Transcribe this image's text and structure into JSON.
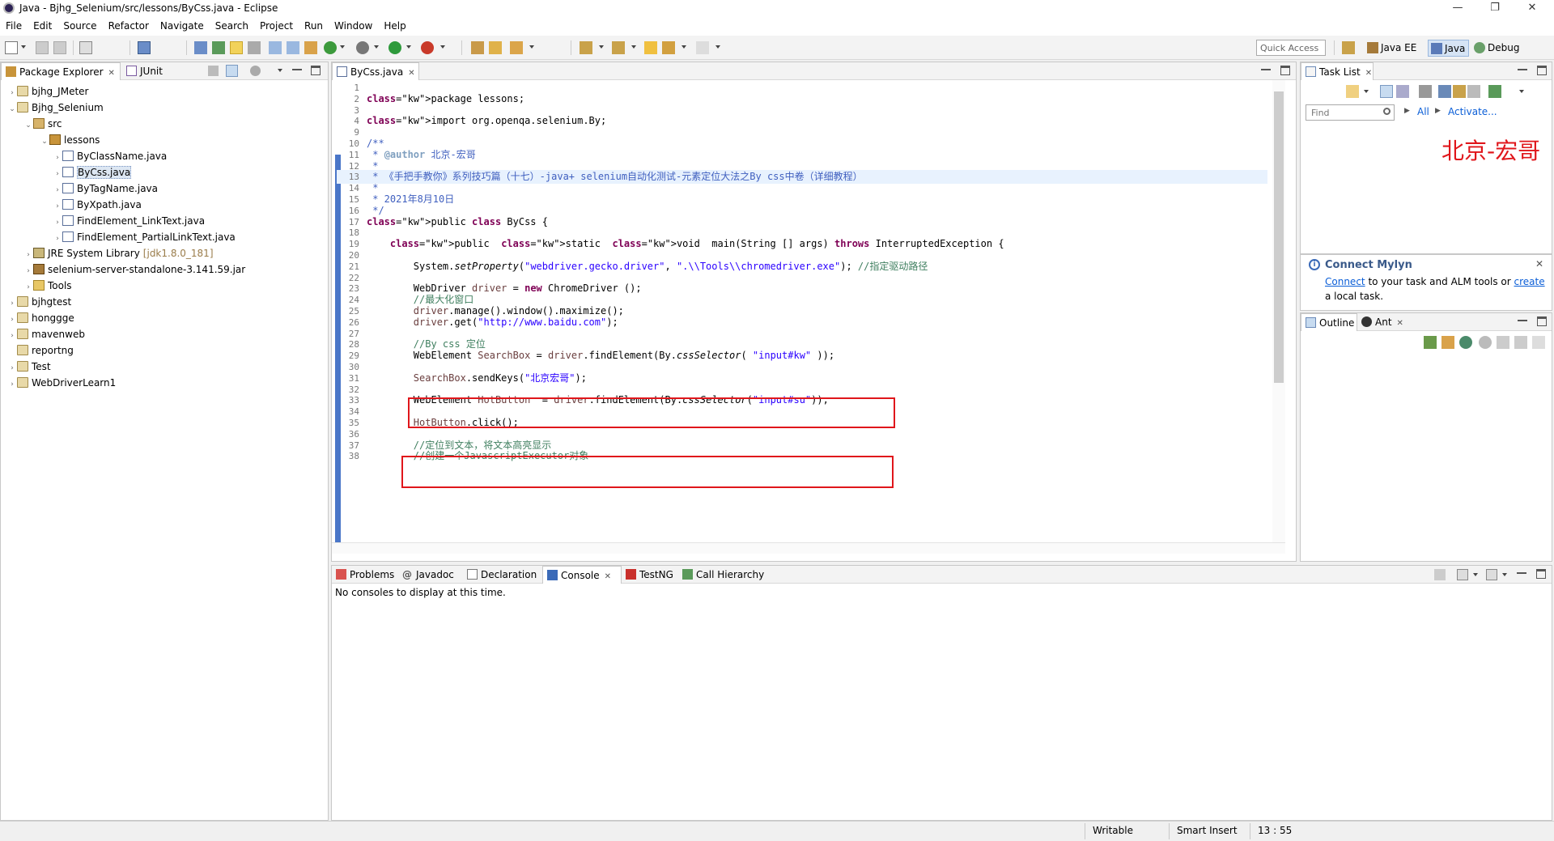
{
  "window": {
    "title": "Java - Bjhg_Selenium/src/lessons/ByCss.java - Eclipse",
    "minimize": "—",
    "restore": "❐",
    "close": "✕"
  },
  "menu": [
    "File",
    "Edit",
    "Source",
    "Refactor",
    "Navigate",
    "Search",
    "Project",
    "Run",
    "Window",
    "Help"
  ],
  "toolbar": {
    "quick_access": "Quick Access",
    "perspectives": [
      "Java EE",
      "Java",
      "Debug"
    ]
  },
  "package_explorer": {
    "tabs": [
      "Package Explorer",
      "JUnit"
    ],
    "tree": [
      {
        "label": "bjhg_JMeter",
        "arrow": "›",
        "icon": "project-icon"
      },
      {
        "label": "Bjhg_Selenium",
        "arrow": "⌄",
        "icon": "project-icon"
      },
      {
        "label": "src",
        "arrow": "⌄",
        "icon": "source-folder-icon"
      },
      {
        "label": "lessons",
        "arrow": "⌄",
        "icon": "package-icon"
      },
      {
        "label": "ByClassName.java",
        "arrow": "›",
        "icon": "java-file-icon"
      },
      {
        "label": "ByCss.java",
        "arrow": "›",
        "icon": "java-file-icon"
      },
      {
        "label": "ByTagName.java",
        "arrow": "›",
        "icon": "java-file-icon"
      },
      {
        "label": "ByXpath.java",
        "arrow": "›",
        "icon": "java-file-icon"
      },
      {
        "label": "FindElement_LinkText.java",
        "arrow": "›",
        "icon": "java-file-icon"
      },
      {
        "label": "FindElement_PartialLinkText.java",
        "arrow": "›",
        "icon": "java-file-icon"
      },
      {
        "label": "JRE System Library",
        "suffix": "[jdk1.8.0_181]",
        "arrow": "›",
        "icon": "library-icon"
      },
      {
        "label": "selenium-server-standalone-3.141.59.jar",
        "arrow": "›",
        "icon": "jar-icon"
      },
      {
        "label": "Tools",
        "arrow": "›",
        "icon": "folder-icon"
      },
      {
        "label": "bjhgtest",
        "arrow": "›",
        "icon": "project-icon"
      },
      {
        "label": "honggge",
        "arrow": "›",
        "icon": "project-icon"
      },
      {
        "label": "mavenweb",
        "arrow": "›",
        "icon": "project-icon"
      },
      {
        "label": "reportng",
        "arrow": "",
        "icon": "project-icon"
      },
      {
        "label": "Test",
        "arrow": "›",
        "icon": "project-icon"
      },
      {
        "label": "WebDriverLearn1",
        "arrow": "›",
        "icon": "project-icon"
      }
    ]
  },
  "editor": {
    "tab": "ByCss.java",
    "lines": [
      {
        "n": "1",
        "t": ""
      },
      {
        "n": "2",
        "t": "package lessons;"
      },
      {
        "n": "3",
        "t": ""
      },
      {
        "n": "4",
        "t": "import org.openqa.selenium.By;"
      },
      {
        "n": "9",
        "t": ""
      },
      {
        "n": "10",
        "t": "/**"
      },
      {
        "n": "11",
        "t": " * @author 北京-宏哥"
      },
      {
        "n": "12",
        "t": " *"
      },
      {
        "n": "13",
        "t": " * 《手把手教你》系列技巧篇（十七）-java+ selenium自动化测试-元素定位大法之By css中卷（详细教程）"
      },
      {
        "n": "14",
        "t": " *"
      },
      {
        "n": "15",
        "t": " * 2021年8月10日"
      },
      {
        "n": "16",
        "t": " */"
      },
      {
        "n": "17",
        "t": "public class ByCss {"
      },
      {
        "n": "18",
        "t": ""
      },
      {
        "n": "19",
        "t": "    public  static  void  main(String [] args) throws InterruptedException {"
      },
      {
        "n": "20",
        "t": ""
      },
      {
        "n": "21",
        "t": "        System.setProperty(\"webdriver.gecko.driver\", \".\\\\Tools\\\\chromedriver.exe\"); //指定驱动路径"
      },
      {
        "n": "22",
        "t": ""
      },
      {
        "n": "23",
        "t": "        WebDriver driver = new ChromeDriver ();"
      },
      {
        "n": "24",
        "t": "        //最大化窗口"
      },
      {
        "n": "25",
        "t": "        driver.manage().window().maximize();"
      },
      {
        "n": "26",
        "t": "        driver.get(\"http://www.baidu.com\");"
      },
      {
        "n": "27",
        "t": ""
      },
      {
        "n": "28",
        "t": "        //By css 定位"
      },
      {
        "n": "29",
        "t": "        WebElement SearchBox = driver.findElement(By.cssSelector( \"input#kw\" ));"
      },
      {
        "n": "30",
        "t": ""
      },
      {
        "n": "31",
        "t": "        SearchBox.sendKeys(\"北京宏哥\");"
      },
      {
        "n": "32",
        "t": ""
      },
      {
        "n": "33",
        "t": "        WebElement HotButton  = driver.findElement(By.cssSelector(\"input#su\"));"
      },
      {
        "n": "34",
        "t": ""
      },
      {
        "n": "35",
        "t": "        HotButton.click();"
      },
      {
        "n": "36",
        "t": ""
      },
      {
        "n": "37",
        "t": "        //定位到文本，将文本高亮显示"
      },
      {
        "n": "38",
        "t": "        //创建一个JavascriptExecutor对象"
      }
    ],
    "highlight_color": "#e0161b"
  },
  "task_list": {
    "tab": "Task List",
    "find_placeholder": "Find",
    "all_label": "All",
    "activate_label": "Activate...",
    "watermark": "北京-宏哥"
  },
  "mylyn": {
    "title": "Connect Mylyn",
    "text_connect": "Connect",
    "text_middle": " to your task and ALM tools or ",
    "text_create": "create",
    "text_end": "a local task."
  },
  "outline": {
    "tabs": [
      "Outline",
      "Ant"
    ]
  },
  "bottom": {
    "tabs": [
      "Problems",
      "Javadoc",
      "Declaration",
      "Console",
      "TestNG",
      "Call Hierarchy"
    ],
    "message": "No consoles to display at this time."
  },
  "status": {
    "writable": "Writable",
    "insert_mode": "Smart Insert",
    "position": "13 : 55"
  }
}
